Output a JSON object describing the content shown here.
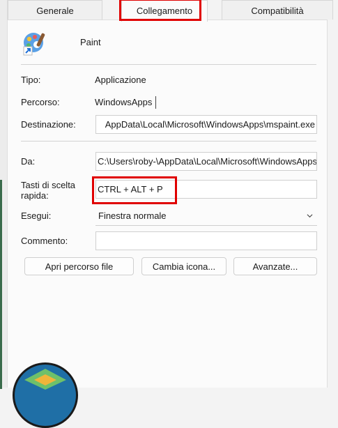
{
  "tabs": [
    {
      "label": "Generale"
    },
    {
      "label": "Collegamento"
    },
    {
      "label": "Compatibilità"
    }
  ],
  "app": {
    "name": "Paint",
    "icon": "paint-palette-icon"
  },
  "fields": {
    "tipo": {
      "label": "Tipo:",
      "value": "Applicazione"
    },
    "percorso": {
      "label": "Percorso:",
      "value": "WindowsApps"
    },
    "destinazione": {
      "label": "Destinazione:",
      "value": "AppData\\Local\\Microsoft\\WindowsApps\\mspaint.exe"
    },
    "da": {
      "label": "Da:",
      "value": "C:\\Users\\roby-\\AppData\\Local\\Microsoft\\WindowsApps"
    },
    "tasti": {
      "label_line1": "Tasti di scelta",
      "label_line2": "rapida:",
      "value": "CTRL + ALT + P"
    },
    "esegui": {
      "label": "Esegui:",
      "value": "Finestra normale"
    },
    "commento": {
      "label": "Commento:",
      "value": ""
    }
  },
  "buttons": {
    "open_path": "Apri percorso file",
    "change_icon": "Cambia icona...",
    "advanced": "Avanzate..."
  },
  "colors": {
    "highlight": "#e00000",
    "accent": "#1f6fa6"
  }
}
